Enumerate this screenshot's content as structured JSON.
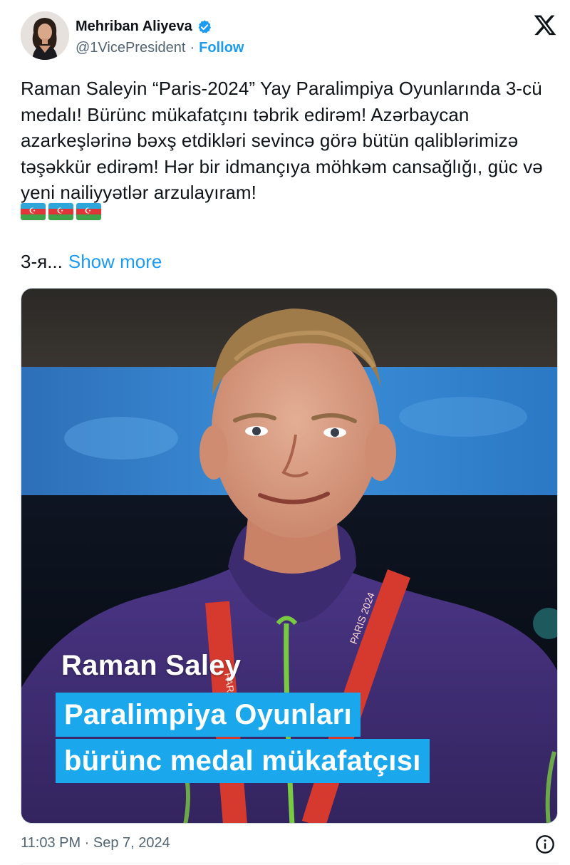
{
  "author": {
    "name": "Mehriban Aliyeva",
    "handle": "@1VicePresident",
    "separator": "·",
    "follow_label": "Follow"
  },
  "tweet": {
    "text": "Raman Saleyin “Paris-2024” Yay Paralimpiya Oyunlarında 3-cü medalı! Bürünc mükafatçını təbrik edirəm! Azərbaycan azarkeşlərinə bəxş etdikləri sevincə görə bütün qaliblərimizə təşəkkür edirəm! Hər bir idmançıya möhkəm cansağlığı, güc və yeni nailiyyətlər arzulayıram!",
    "flag_emoji": [
      "🇦🇿",
      "🇦🇿",
      "🇦🇿"
    ],
    "truncated_text": "3-я...",
    "show_more_label": "Show more"
  },
  "media": {
    "caption_name": "Raman Saley",
    "caption_line1": "Paralimpiya Oyunları",
    "caption_line2": "bürünc medal mükafatçısı",
    "medal_ribbon_text": "PARIS 2024"
  },
  "footer": {
    "timestamp": "11:03 PM · Sep 7, 2024"
  },
  "icons": {
    "verified": "verified-badge-icon",
    "x_logo": "x-logo-icon",
    "info": "info-icon"
  },
  "colors": {
    "accent": "#1d9bf0",
    "caption_band": "#1aa7ec",
    "muted_text": "#536471"
  }
}
